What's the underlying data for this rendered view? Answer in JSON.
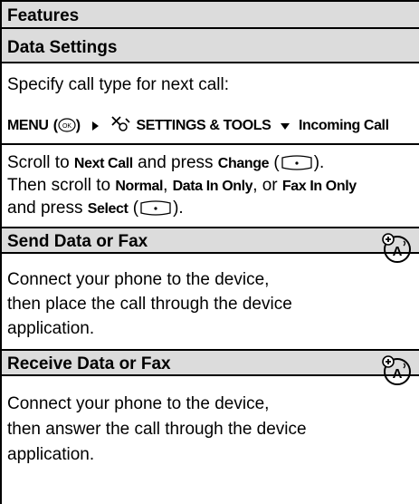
{
  "header": {
    "title": "Features"
  },
  "data_settings": {
    "title": "Data Settings",
    "intro": "Specify call type for next call:",
    "path": {
      "menu": "MENU",
      "settings": "SETTINGS & TOOLS",
      "incoming": "Incoming Call",
      "icons": [
        "ok-key-icon",
        "triangle-right-icon",
        "settings-tools-icon",
        "down-arrow-icon"
      ]
    },
    "line1": {
      "a": "Scroll to ",
      "b": "Next Call",
      "c": " and press ",
      "d": "Change",
      "e": " (",
      "f": ")."
    },
    "line2": {
      "a": "Then scroll to ",
      "b": "Normal",
      "c": ", ",
      "d": "Data In Only",
      "e": ", or ",
      "f": "Fax In Only"
    },
    "line3": {
      "a": "and press ",
      "b": "Select",
      "c": " (",
      "d": ")."
    }
  },
  "send": {
    "title": "Send Data or Fax",
    "lines": [
      "Connect your phone to the device,",
      "then place the call through the device",
      "application."
    ],
    "icon": "network-feature-icon"
  },
  "receive": {
    "title": "Receive Data or Fax",
    "lines": [
      "Connect your phone to the device,",
      "then answer the call through the device",
      "application."
    ],
    "icon": "network-feature-icon"
  }
}
